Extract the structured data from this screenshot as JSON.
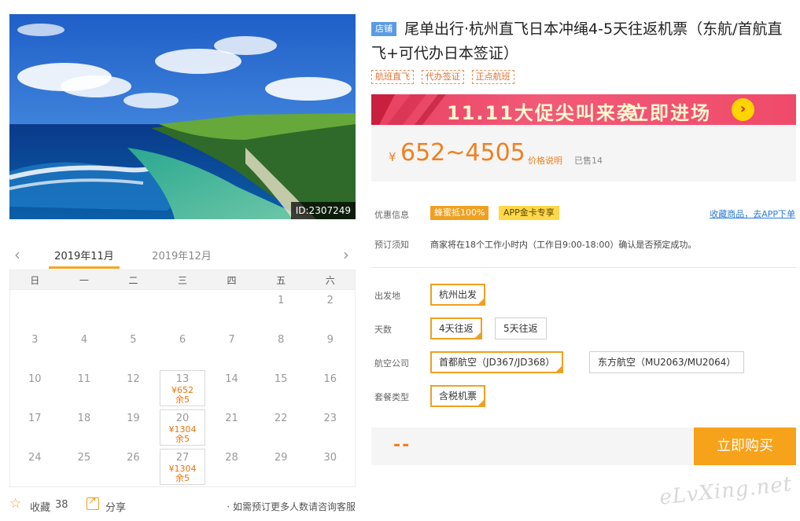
{
  "photo": {
    "id_label": "ID:2307249"
  },
  "calendar": {
    "months": [
      "2019年11月",
      "2019年12月"
    ],
    "weekdays": [
      "日",
      "一",
      "二",
      "三",
      "四",
      "五",
      "六"
    ],
    "days": [
      "",
      "",
      "",
      "",
      "",
      "1",
      "2",
      "3",
      "4",
      "5",
      "6",
      "7",
      "8",
      "9",
      "10",
      "11",
      "12",
      "13",
      "14",
      "15",
      "16",
      "17",
      "18",
      "19",
      "20",
      "21",
      "22",
      "23",
      "24",
      "25",
      "26",
      "27",
      "28",
      "29",
      "30"
    ],
    "available": [
      {
        "day": "13",
        "price": "¥652",
        "left": "余5"
      },
      {
        "day": "20",
        "price": "¥1304",
        "left": "余5"
      },
      {
        "day": "27",
        "price": "¥1304",
        "left": "余5"
      }
    ]
  },
  "footer": {
    "fav_label": "收藏",
    "fav_count": "38",
    "share_label": "分享",
    "note": "· 如需预订更多人数请咨询客服"
  },
  "product": {
    "shop_badge": "店铺",
    "title": "尾单出行·杭州直飞日本冲绳4-5天往返机票（东航/首航直飞+可代办日本签证）",
    "tags": [
      "航班直飞",
      "代办签证",
      "正点航班"
    ]
  },
  "promo": {
    "text": "11.11大促尖叫来袭",
    "cta": "立即进场",
    "arrow": "›"
  },
  "price": {
    "yen": "¥",
    "range": "652~4505",
    "explain": "价格说明",
    "sold": "已售14"
  },
  "info": {
    "discount_label": "优惠信息",
    "badge1": "蜂蜜抵100%",
    "badge2": "APP金卡专享",
    "app_link": "收藏商品，去APP下单",
    "notice_label": "预订须知",
    "notice_text": "商家将在18个工作小时内（工作日9:00-18:00）确认是否预定成功。"
  },
  "options": {
    "departure_label": "出发地",
    "departure": [
      "杭州出发"
    ],
    "days_label": "天数",
    "days": [
      "4天往返",
      "5天往返"
    ],
    "airline_label": "航空公司",
    "airlines": [
      "首都航空（JD367/JD368）",
      "东方航空（MU2063/MU2064）"
    ],
    "package_label": "套餐类型",
    "packages": [
      "含税机票"
    ]
  },
  "buy": {
    "price_placeholder": "--",
    "button": "立即购买"
  },
  "watermark": "eLvXing.net"
}
